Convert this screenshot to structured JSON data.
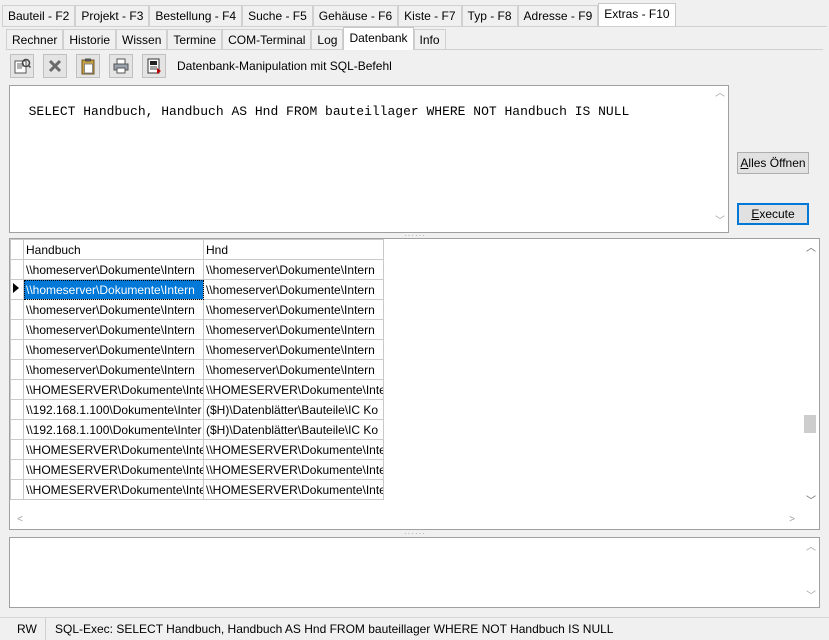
{
  "main_tabs": [
    {
      "label": "Bauteil - F2"
    },
    {
      "label": "Projekt - F3"
    },
    {
      "label": "Bestellung - F4"
    },
    {
      "label": "Suche - F5"
    },
    {
      "label": "Gehäuse - F6"
    },
    {
      "label": "Kiste - F7"
    },
    {
      "label": "Typ - F8"
    },
    {
      "label": "Adresse - F9"
    },
    {
      "label": "Extras - F10",
      "active": true
    }
  ],
  "sub_tabs": [
    {
      "label": "Rechner"
    },
    {
      "label": "Historie"
    },
    {
      "label": "Wissen"
    },
    {
      "label": "Termine"
    },
    {
      "label": "COM-Terminal"
    },
    {
      "label": "Log"
    },
    {
      "label": "Datenbank",
      "active": true
    },
    {
      "label": "Info"
    }
  ],
  "toolbar": {
    "buttons": [
      {
        "icon": "open-query-icon"
      },
      {
        "icon": "delete-icon"
      },
      {
        "icon": "clipboard-icon"
      },
      {
        "icon": "print-icon"
      },
      {
        "icon": "export-icon"
      }
    ],
    "label": "Datenbank-Manipulation mit SQL-Befehl"
  },
  "sql": {
    "query": "SELECT Handbuch, Handbuch AS Hnd FROM bauteillager WHERE NOT Handbuch IS NULL"
  },
  "buttons": {
    "open_all": {
      "prefix": "",
      "underlined": "A",
      "rest": "lles Öffnen"
    },
    "execute": {
      "prefix": "",
      "underlined": "E",
      "rest": "xecute"
    }
  },
  "grid": {
    "columns": [
      "Handbuch",
      "Hnd"
    ],
    "current_row": 1,
    "rows": [
      [
        "\\\\homeserver\\Dokumente\\Intern",
        "\\\\homeserver\\Dokumente\\Intern"
      ],
      [
        "\\\\homeserver\\Dokumente\\Intern",
        "\\\\homeserver\\Dokumente\\Intern"
      ],
      [
        "\\\\homeserver\\Dokumente\\Intern",
        "\\\\homeserver\\Dokumente\\Intern"
      ],
      [
        "\\\\homeserver\\Dokumente\\Intern",
        "\\\\homeserver\\Dokumente\\Intern"
      ],
      [
        "\\\\homeserver\\Dokumente\\Intern",
        "\\\\homeserver\\Dokumente\\Intern"
      ],
      [
        "\\\\homeserver\\Dokumente\\Intern",
        "\\\\homeserver\\Dokumente\\Intern"
      ],
      [
        "\\\\HOMESERVER\\Dokumente\\Inte",
        "\\\\HOMESERVER\\Dokumente\\Inte"
      ],
      [
        "\\\\192.168.1.100\\Dokumente\\Inter",
        "($H)\\Datenblätter\\Bauteile\\IC Ko"
      ],
      [
        "\\\\192.168.1.100\\Dokumente\\Inter",
        "($H)\\Datenblätter\\Bauteile\\IC Ko"
      ],
      [
        "\\\\HOMESERVER\\Dokumente\\Inte",
        "\\\\HOMESERVER\\Dokumente\\Inte"
      ],
      [
        "\\\\HOMESERVER\\Dokumente\\Inte",
        "\\\\HOMESERVER\\Dokumente\\Inte"
      ],
      [
        "\\\\HOMESERVER\\Dokumente\\Inte",
        "\\\\HOMESERVER\\Dokumente\\Inte"
      ]
    ]
  },
  "output": {
    "text": ""
  },
  "status": {
    "mode": "RW",
    "message": "SQL-Exec: SELECT Handbuch, Handbuch AS Hnd FROM bauteillager WHERE NOT Handbuch IS NULL"
  },
  "colors": {
    "selection": "#0078d7",
    "default_button_border": "#0078d7"
  }
}
